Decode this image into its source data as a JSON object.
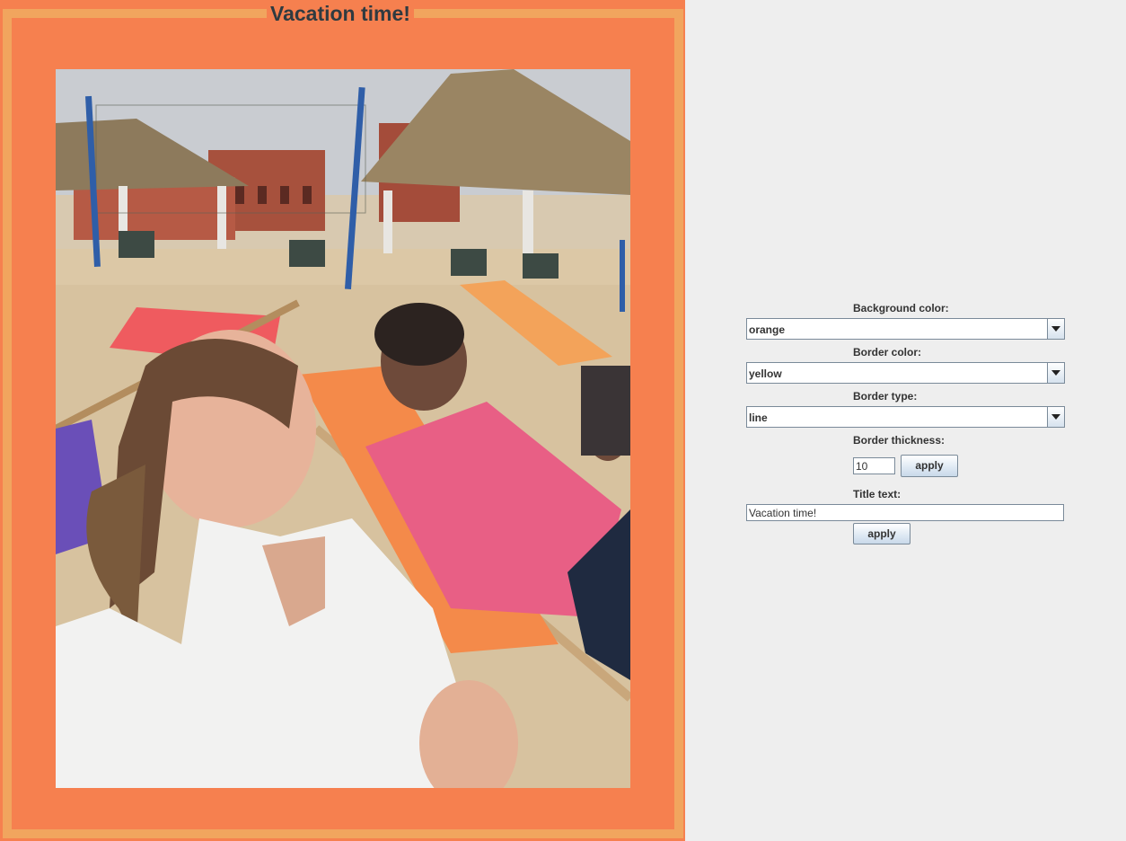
{
  "frame": {
    "title": "Vacation time!",
    "background_color": "#f6804f",
    "border_color": "#f1a55e",
    "photo_alt": "Photo: two people relaxing in deck chairs at a city beach"
  },
  "controls": {
    "background_color_label": "Background color:",
    "background_color_value": "orange",
    "border_color_label": "Border color:",
    "border_color_value": "yellow",
    "border_type_label": "Border type:",
    "border_type_value": "line",
    "border_thickness_label": "Border thickness:",
    "border_thickness_value": "10",
    "thickness_apply_label": "apply",
    "title_text_label": "Title text:",
    "title_text_value": "Vacation time!",
    "title_apply_label": "apply"
  },
  "icons": {
    "dropdown_arrow": "chevron-down-icon"
  }
}
